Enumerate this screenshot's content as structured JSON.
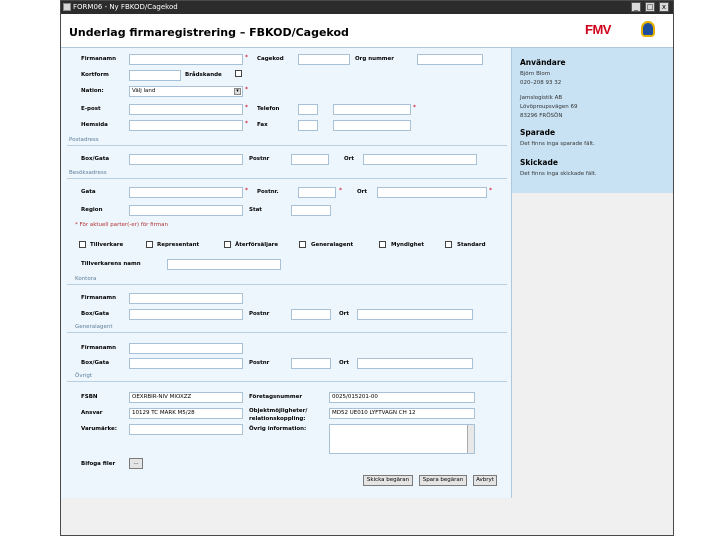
{
  "window": {
    "title": "FORM06 - Ny FBKOD/Cagekod",
    "minimize": "_",
    "maximize": "□",
    "close": "x"
  },
  "header": {
    "title": "Underlag firmaregistrering – FBKOD/Cagekod",
    "logo": "FMV"
  },
  "sidebar": {
    "user_heading": "Användare",
    "user_name": "Björn Blom",
    "user_phone": "020–208 93 32",
    "org_name": "Jamslogistik AB",
    "org_street": "Lövöproupsvägen 69",
    "org_city": "83296 FRÖSÖN",
    "saved_heading": "Sparade",
    "saved_text": "Det finns inga sparade fält.",
    "sent_heading": "Skickade",
    "sent_text": "Det finns inga skickade fält."
  },
  "form": {
    "firmanamn": "Firmanamn",
    "cagekod": "Cagekod",
    "org_nummer": "Org nummer",
    "kortform": "Kortform",
    "bradskande": "Brådskande",
    "nation": "Nation:",
    "nation_value": "Välj land",
    "epost": "E-post",
    "telefon": "Telefon",
    "hemsida": "Hemsida",
    "fax": "Fax",
    "postadress": "Postadress",
    "box_gata": "Box/Gata",
    "postnr": "Postnr",
    "ort": "Ort",
    "besoksadress": "Besöksadress",
    "gata": "Gata",
    "postnr2": "Postnr.",
    "ort2": "Ort",
    "region": "Region",
    "stat": "Stat",
    "choose_note": "* För aktuell parter(-er) för firman",
    "checkboxes": [
      "Tillverkare",
      "Representant",
      "Återförsäljare",
      "Generalagent",
      "Myndighet",
      "Standard"
    ],
    "tillverkarens_namn": "Tillverkarens namn",
    "kontora": "Kontora",
    "k_firmanamn": "Firmanamn",
    "k_box": "Box/Gata",
    "k_postnr": "Postnr",
    "k_ort": "Ort",
    "generalagent": "Generalagent",
    "g_firmanamn": "Firmanamn",
    "g_box": "Box/Gata",
    "g_postnr": "Postnr",
    "g_ort": "Ort",
    "ovrigt": "Övrigt",
    "fsbn": "FSBN",
    "fsbn_value": "OEXRBIR-NIV MIOXZZ",
    "foretagsnummer": "Företagsnummer",
    "foretagsnummer_value": "0025/015201-00",
    "ansvar": "Ansvar",
    "ansvar_value": "10129 TC MARK M5/28",
    "objekt": "Objektmöjligheter/",
    "relation": "relationskoppling:",
    "objekt_value": "MD52 UE010 LYFTVAGN CH 12",
    "varumarke": "Varumärke:",
    "ovrig_info": "Övrig information:",
    "bifoga_filer": "Bifoga filer",
    "browse": "...",
    "skicka": "Skicka begäran",
    "spara": "Spara begäran",
    "avbryt": "Avbryt"
  }
}
